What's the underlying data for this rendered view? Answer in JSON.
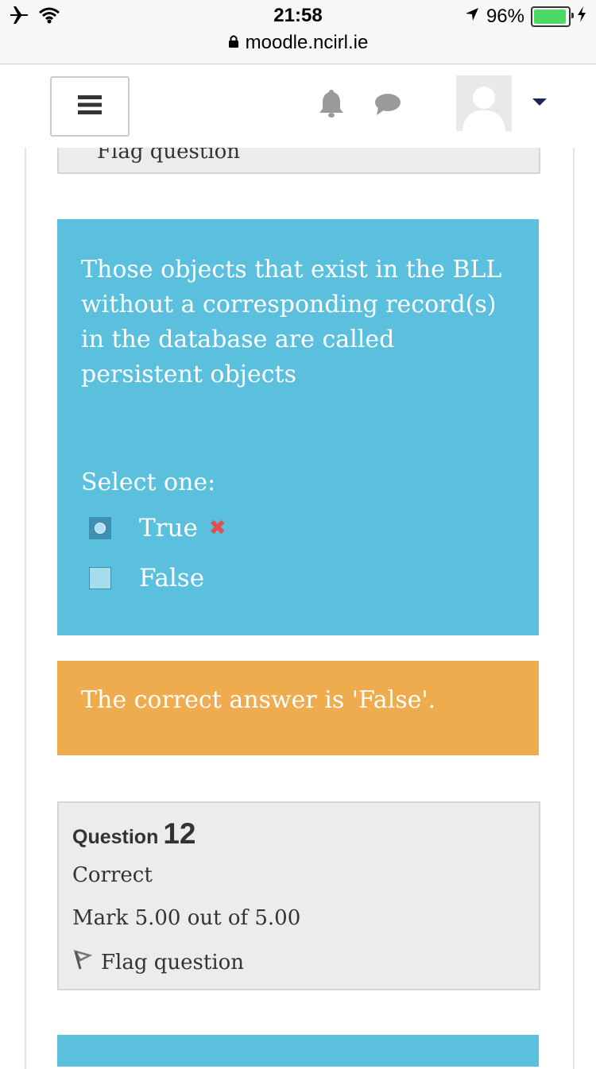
{
  "status_bar": {
    "time": "21:58",
    "url": "moodle.ncirl.ie",
    "battery_percent": "96%",
    "battery_level": 0.96,
    "icons": [
      "airplane-icon",
      "wifi-icon",
      "location-arrow-icon",
      "battery-icon",
      "charging-icon",
      "lock-icon"
    ]
  },
  "nav": {
    "icons": [
      "hamburger-menu-icon",
      "notification-bell-icon",
      "messages-icon",
      "user-avatar",
      "user-menu-caret-icon"
    ]
  },
  "previous_info": {
    "flag_label": "Flag question"
  },
  "question": {
    "text": "Those objects that exist in the BLL without a corresponding record(s) in the database are called persistent objects",
    "prompt": "Select one:",
    "options": [
      {
        "label": "True",
        "selected": true,
        "marked_incorrect": true
      },
      {
        "label": "False",
        "selected": false
      }
    ],
    "colors": {
      "background": "#5bbfde",
      "text": "#ffffff",
      "incorrect_mark": "#e04e4e"
    }
  },
  "feedback": {
    "text": "The correct answer is 'False'.",
    "background": "#efac4e"
  },
  "next_question_info": {
    "label": "Question",
    "number": "12",
    "state": "Correct",
    "grade": "Mark 5.00 out of 5.00",
    "flag_label": "Flag question"
  }
}
